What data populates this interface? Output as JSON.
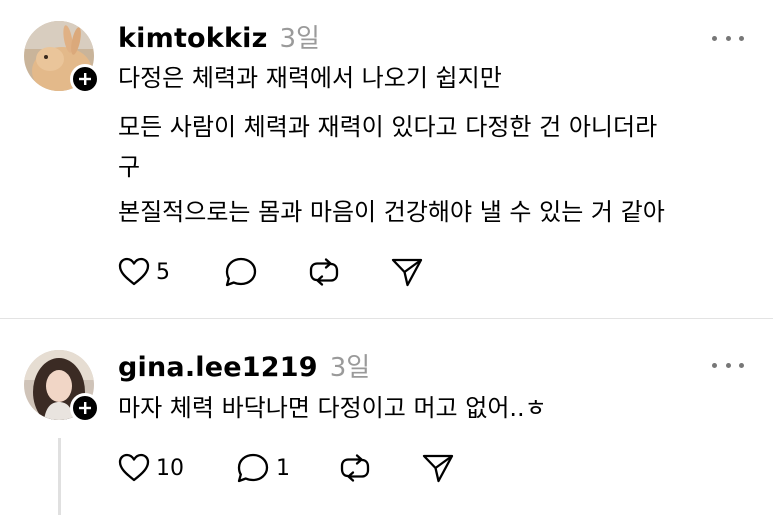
{
  "posts": [
    {
      "username": "kimtokkiz",
      "time": "3일",
      "lines": [
        "다정은 체력과 재력에서 나오기 쉽지만",
        "모든 사람이 체력과 재력이 있다고 다정한 건 아니더라",
        "구",
        "본질적으로는 몸과 마음이 건강해야 낼 수 있는 거 같아"
      ],
      "likes": "5",
      "replies": ""
    },
    {
      "username": "gina.lee1219",
      "time": "3일",
      "lines": [
        "마자 체력 바닥나면 다정이고 머고 없어..ㅎ"
      ],
      "likes": "10",
      "replies": "1"
    }
  ],
  "icons": {
    "like": "heart-icon",
    "reply": "comment-icon",
    "repost": "repost-icon",
    "share": "send-icon",
    "more": "more-icon",
    "follow": "plus-icon"
  },
  "colors": {
    "text": "#000000",
    "muted": "#9a9a9a",
    "divider": "#e3e3e3"
  }
}
